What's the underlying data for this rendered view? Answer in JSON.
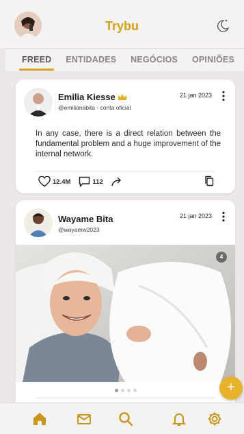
{
  "header": {
    "title": "Trybu",
    "user_avatar": "user-avatar",
    "theme_icon": "moon-icon"
  },
  "tabs": [
    {
      "label": "FREED",
      "active": true
    },
    {
      "label": "ENTIDADES",
      "active": false
    },
    {
      "label": "NEGÓCIOS",
      "active": false
    },
    {
      "label": "OPINIÕES",
      "active": false
    }
  ],
  "posts": [
    {
      "author": "Emilia Kiesse",
      "verified_icon": "crown-icon",
      "handle": "@emilianabita - conta oficial",
      "date": "21 jan 2023",
      "text": "In any case, there is a direct relation between the fundamental problem and a huge improvement of the internal network.",
      "likes": "12.4M",
      "comments": "112"
    },
    {
      "author": "Wayame Bita",
      "handle": "@wayamw2023",
      "date": "21 jan 2023",
      "image_count": "4",
      "carousel_total": 4,
      "carousel_active": 1
    }
  ],
  "fab": {
    "label": "+"
  },
  "bottom_nav": [
    "home-icon",
    "mail-icon",
    "search-icon",
    "bell-icon",
    "settings-icon"
  ],
  "colors": {
    "accent": "#d2a21a",
    "background": "#ece7e8",
    "card": "#ffffff"
  }
}
